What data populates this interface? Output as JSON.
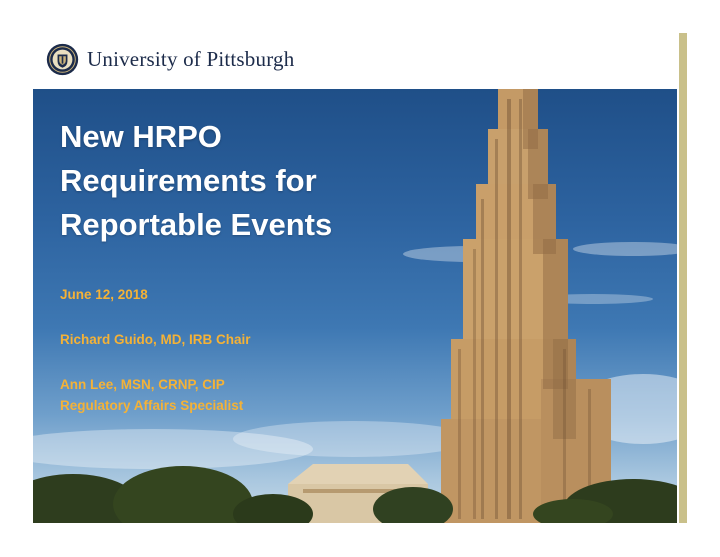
{
  "header": {
    "university_name": "University of Pittsburgh"
  },
  "title": {
    "lines": [
      "New HRPO",
      "Requirements for",
      "Reportable Events"
    ]
  },
  "date": "June 12, 2018",
  "presenters": [
    {
      "line1": "Richard Guido, MD, IRB Chair"
    },
    {
      "line1": "Ann Lee, MSN, CRNP, CIP",
      "line2": "Regulatory Affairs Specialist"
    }
  ],
  "colors": {
    "title_text": "#ffffff",
    "accent_gold": "#f4b237",
    "university_navy": "#1c2b4a",
    "side_bar": "#c9c08a"
  },
  "icons": {
    "seal": "university-seal-icon"
  }
}
